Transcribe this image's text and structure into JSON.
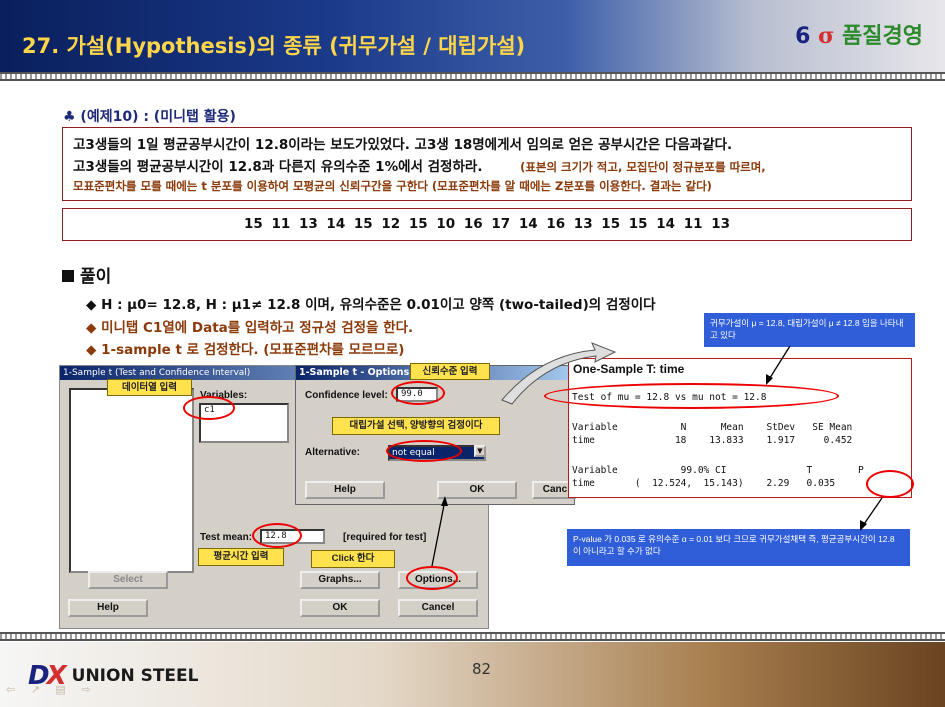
{
  "header": {
    "title": "27. 가설(Hypothesis)의 종류 (귀무가설 / 대립가설)",
    "brand_six": "6",
    "brand_sigma": "σ",
    "brand_text": "품질경영"
  },
  "example": {
    "title": "♣ (예제10) : (미니탭 활용)",
    "line1": "고3생들의 1일 평균공부시간이 12.8이라는 보도가있었다. 고3생 18명에게서 임의로 얻은 공부시간은 다음과같다.",
    "line2": "고3생들의 평균공부시간이 12.8과 다른지 유의수준 1%에서 검정하라.",
    "note1": "(표본의 크기가 적고, 모집단이 정규분포를 따르며,",
    "note2": "모표준편차를 모를 때에는 t 분포를 이용하여 모평균의 신뢰구간을 구한다 (모표준편차를 알 때에는 Z분포를 이용한다. 결과는 같다)"
  },
  "data_values": "15  11  13  14  15  12  15  10  16  17  14  16  13  15  15  14  11  13",
  "solution": {
    "heading": "풀이",
    "line1": "◆ H : μ0= 12.8,  H : μ1≠ 12.8  이며, 유의수준은 0.01이고 양쪽 (two-tailed)의 검정이다",
    "line2": "◆ 미니탭 C1열에 Data를 입력하고 정규성 검정을 한다.",
    "line3": "◆ 1-sample  t 로 검정한다. (모표준편차를 모르므로)"
  },
  "dialog_main": {
    "title": "1-Sample t (Test and Confidence Interval)",
    "variables_label": "Variables:",
    "variables_value": "c1",
    "test_mean_label": "Test mean:",
    "test_mean_value": "12.8",
    "required_note": "[required for test]",
    "select": "Select",
    "graphs": "Graphs...",
    "options": "Options...",
    "help": "Help",
    "ok": "OK",
    "cancel": "Cancel"
  },
  "dialog_options": {
    "title": "1-Sample t - Options",
    "confidence_label": "Confidence level:",
    "confidence_value": "99.0",
    "alternative_label": "Alternative:",
    "alternative_value": "not equal",
    "help": "Help",
    "ok": "OK",
    "cancel": "Canc"
  },
  "output": {
    "title": "One-Sample T: time",
    "test_line": "Test of mu = 12.8 vs mu not = 12.8",
    "h1": "Variable           N      Mean    StDev   SE Mean",
    "r1": "time              18    13.833    1.917     0.452",
    "h2": "Variable           99.0% CI              T        P",
    "r2": "time       (  12.524,  15.143)    2.29   0.035"
  },
  "callouts": {
    "data_input": "데이터열 입력",
    "confidence": "신뢰수준 입력",
    "alt_select": "대립가설 선택, 양방향의 검정이다",
    "mean_input": "평균시간 입력",
    "click": "Click 한다",
    "null_note": "귀무가설이 μ = 12.8,  대립가설이 μ ≠ 12.8  임을 나타내고 있다",
    "pvalue_note": "P-value 가 0.035  로 유의수준  α = 0.01 보다 크므로 귀무가설채택 즉, 평균공부시간이 12.8  이 아니라고 할 수가 없다"
  },
  "footer": {
    "company": "UNION STEEL",
    "page": "82"
  }
}
